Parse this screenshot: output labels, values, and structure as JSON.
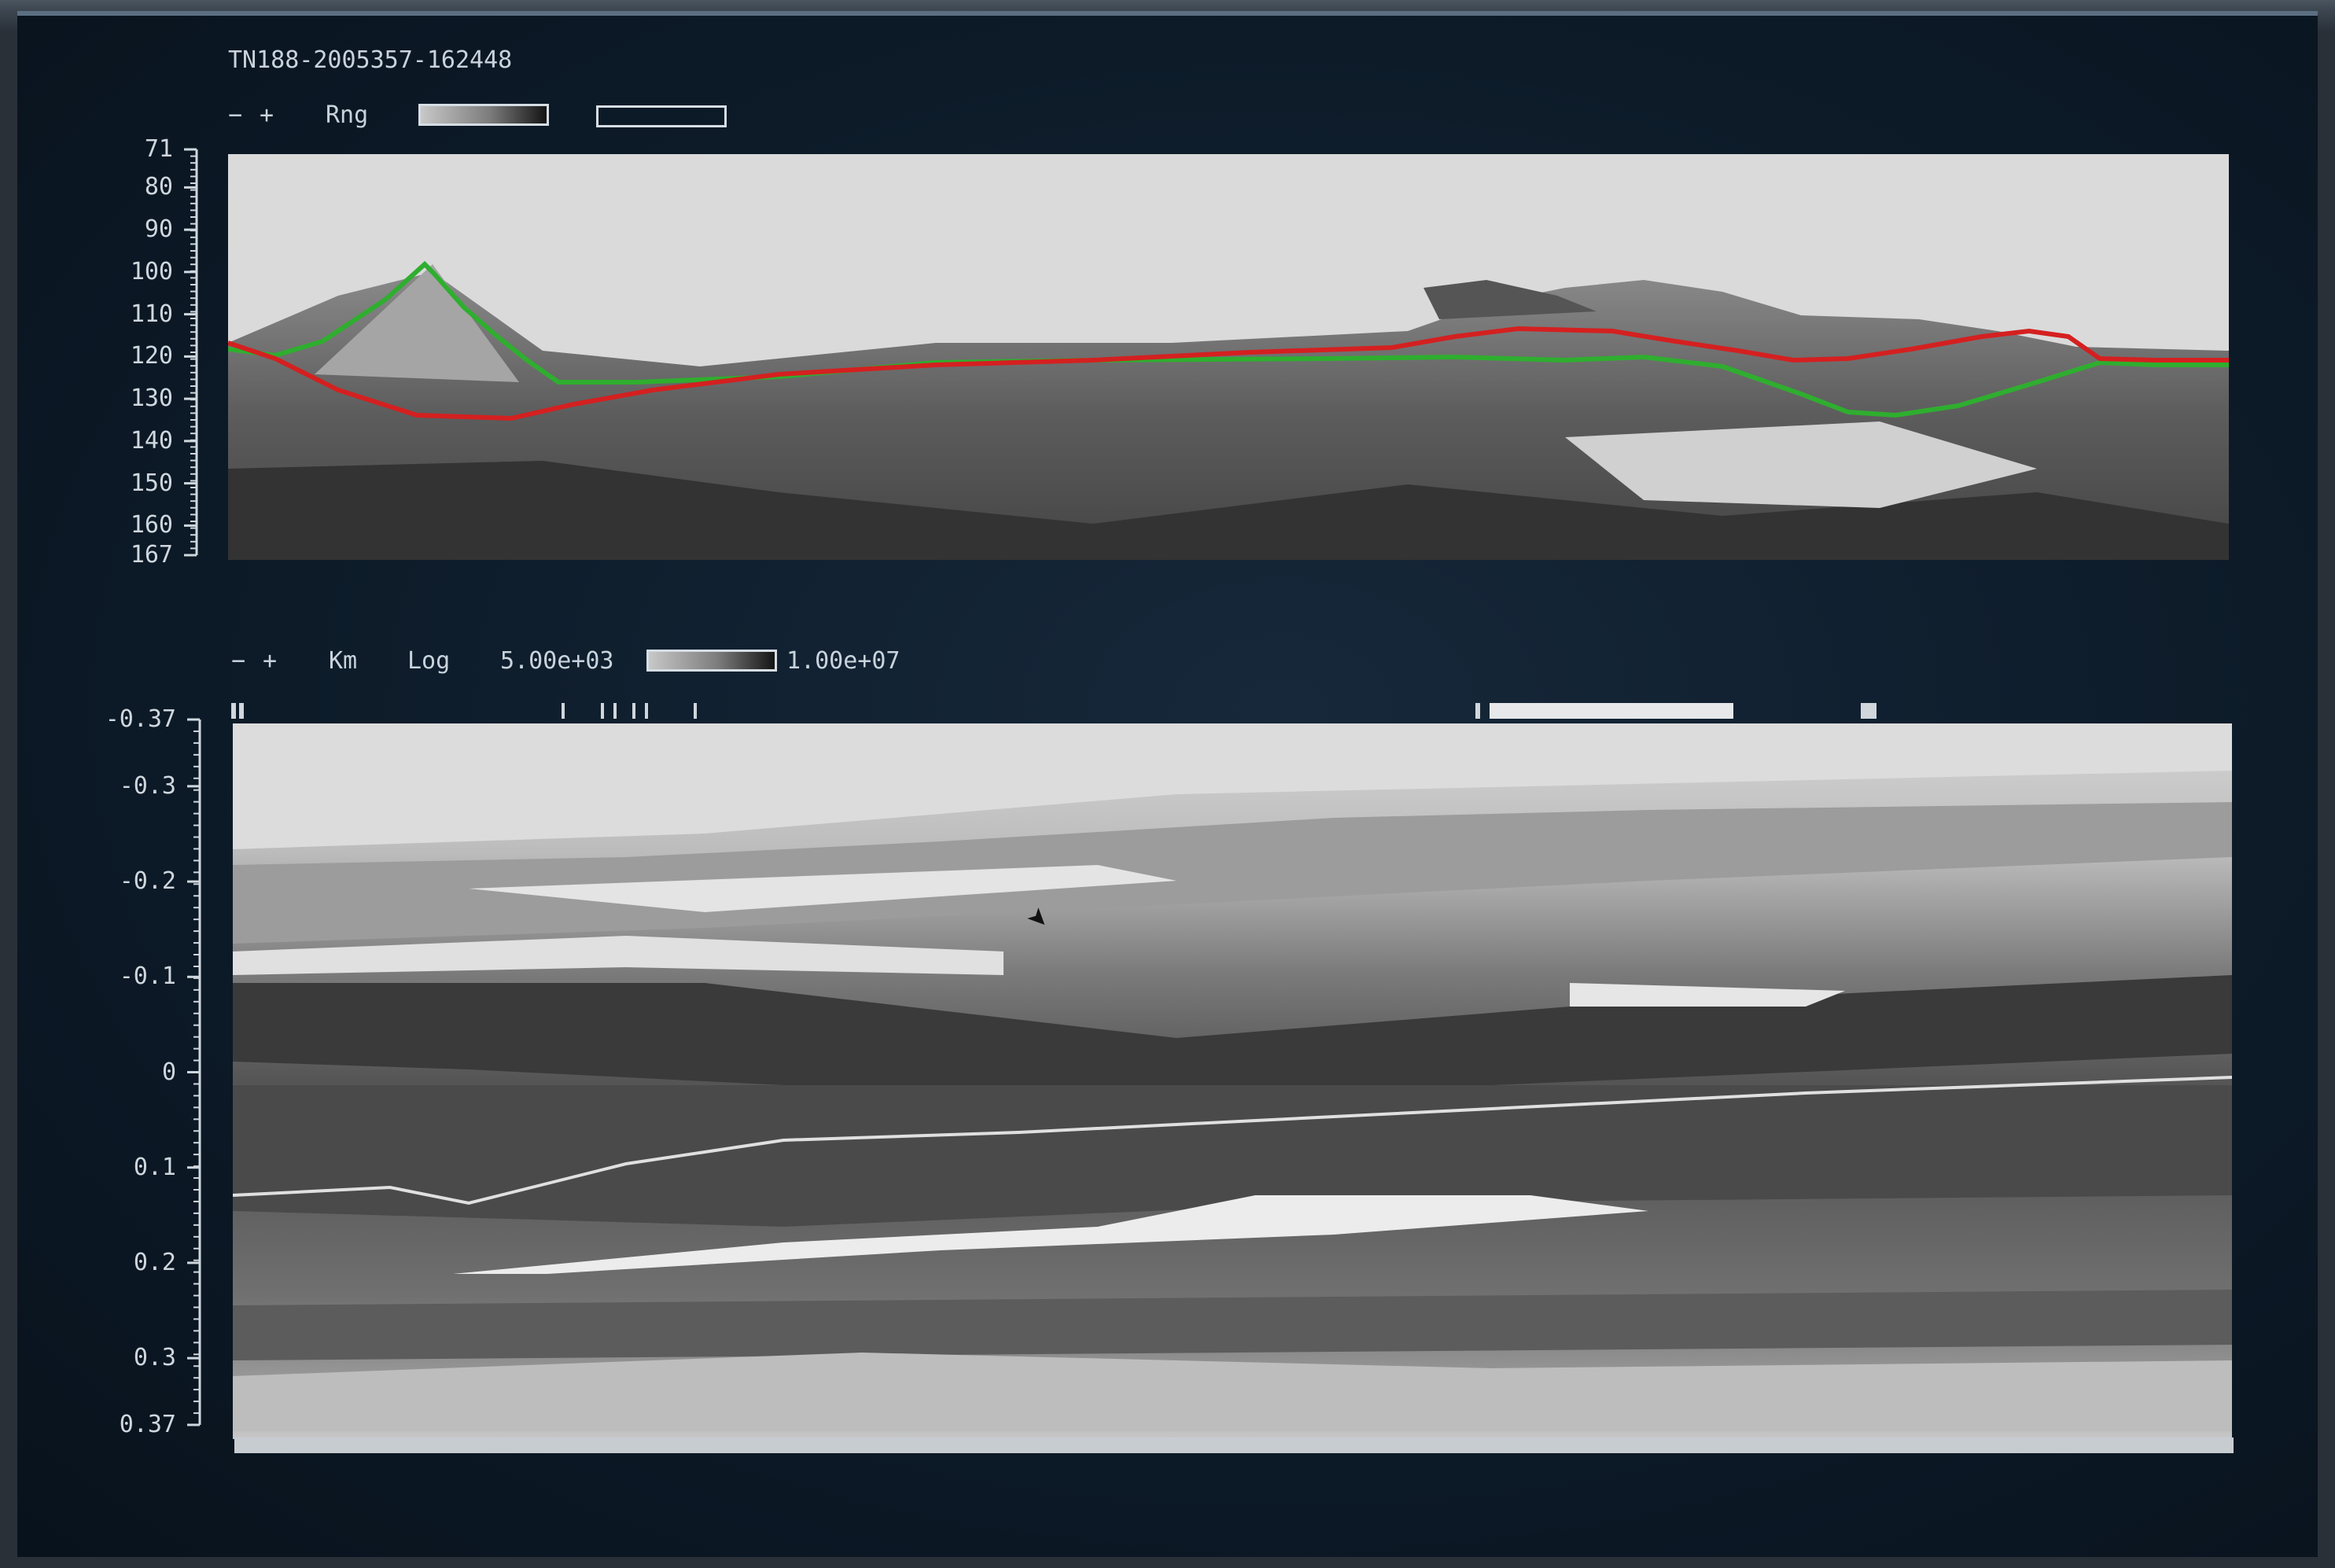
{
  "file_title": "TN188-2005357-162448",
  "top_panel": {
    "zoom_out": "−",
    "zoom_in": "+",
    "mode_label": "Rng",
    "y_ticks": [
      "71",
      "80",
      "90",
      "100",
      "110",
      "120",
      "130",
      "140",
      "150",
      "160",
      "167"
    ],
    "y_min": 71,
    "y_max": 167,
    "red_line_color": "#d42020",
    "green_line_color": "#2fae2f"
  },
  "bottom_panel": {
    "zoom_out": "−",
    "zoom_in": "+",
    "unit_label": "Km",
    "scale_label": "Log",
    "scale_min": "5.00e+03",
    "scale_max": "1.00e+07",
    "y_ticks": [
      "-0.37",
      "-0.3",
      "-0.2",
      "-0.1",
      "0",
      "0.1",
      "0.2",
      "0.3",
      "0.37"
    ],
    "y_min": -0.37,
    "y_max": 0.37
  },
  "colors": {
    "screen_bg": "#0d1b29",
    "text": "#c9d3dc"
  }
}
